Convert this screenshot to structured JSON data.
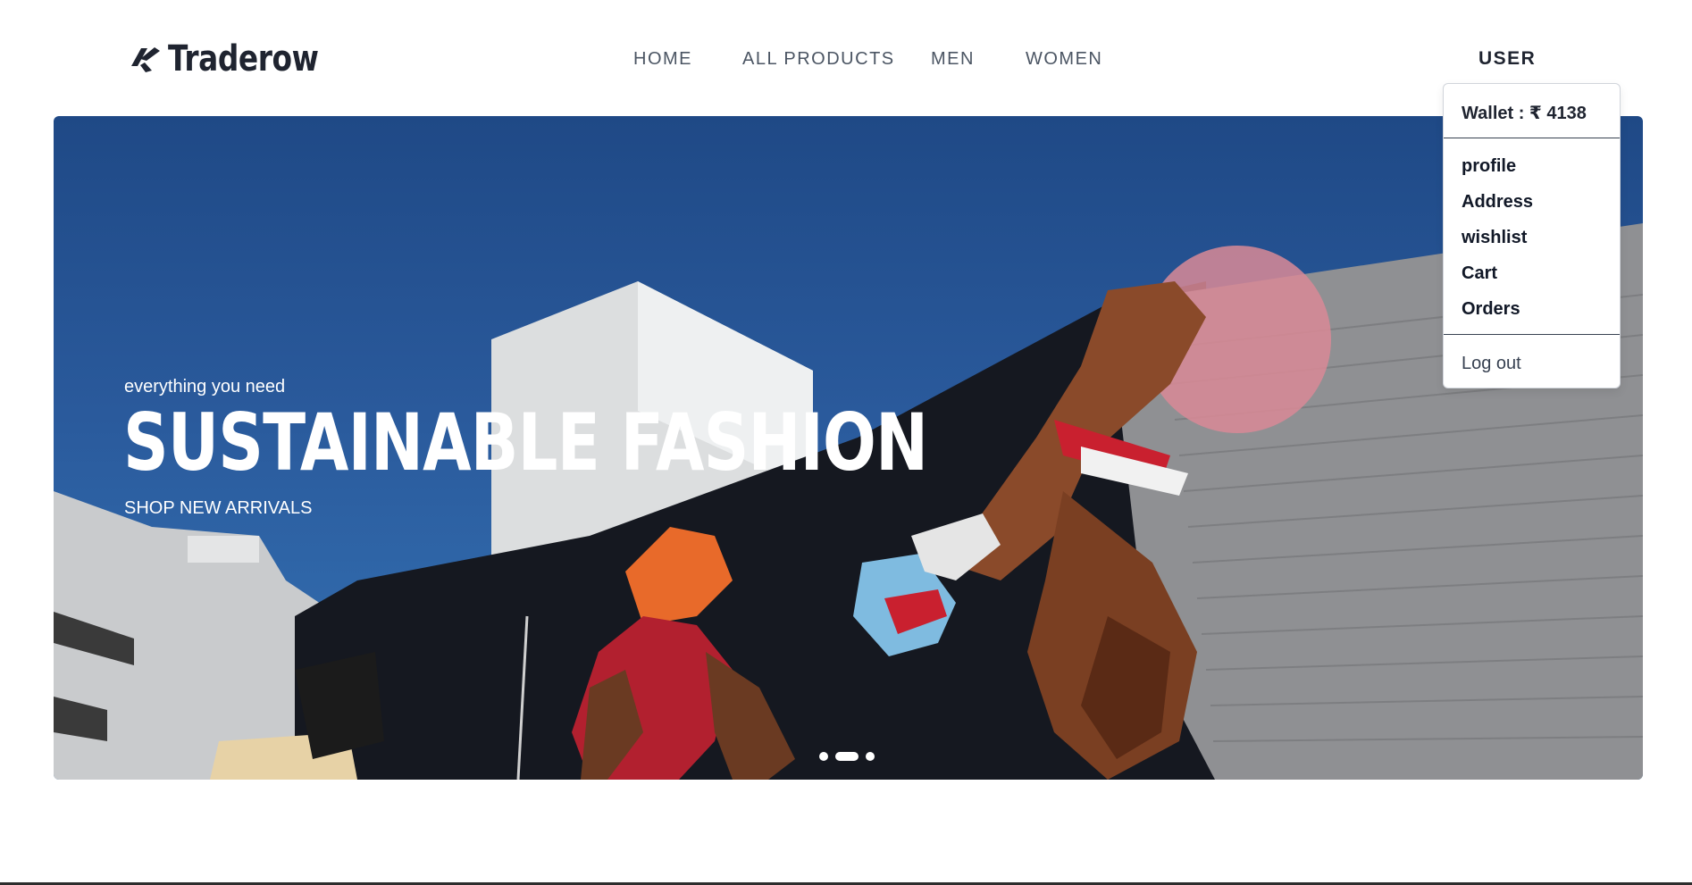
{
  "brand": {
    "name": "Traderow",
    "logo_icon": "traderow-logo-icon"
  },
  "nav": {
    "home": "HOME",
    "all_products": "ALL PRODUCTS",
    "men": "MEN",
    "women": "WOMEN",
    "user": "USER"
  },
  "hero": {
    "subtitle": "everything you need",
    "title": "SUSTAINABLE FASHION",
    "cta": "SHOP NEW ARRIVALS",
    "slide_count": 3,
    "active_slide": 2,
    "image": "basketball-player-mural"
  },
  "user_menu": {
    "wallet": "Wallet : ₹ 4138",
    "items": [
      "profile",
      "Address",
      "wishlist",
      "Cart",
      "Orders"
    ],
    "logout": "Log out"
  },
  "colors": {
    "text_dark": "#1f2430",
    "nav_text": "#4b5563",
    "sky": "#1f4986",
    "white": "#ffffff"
  }
}
